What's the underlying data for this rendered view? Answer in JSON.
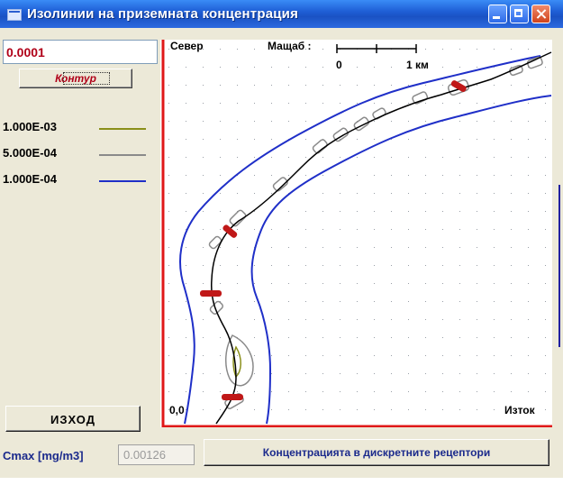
{
  "window": {
    "title": "Изолинии на приземната концентрация"
  },
  "controls": {
    "concentration_value": "0.0001",
    "contour_button": "Контур",
    "exit_button": "ИЗХОД",
    "cmax_label": "Cmax [mg/m3]",
    "cmax_value": "0.00126",
    "receptors_button": "Концентрацията в дискретните рецептори"
  },
  "legend": [
    {
      "label": "1.000E-03",
      "color": "#8a8f1a"
    },
    {
      "label": "5.000E-04",
      "color": "#8a8a8a"
    },
    {
      "label": "1.000E-04",
      "color": "#1f2fc8"
    }
  ],
  "map": {
    "north_label": "Север",
    "scale_label": "Мащаб :",
    "scale_start": "0",
    "scale_end": "1 км",
    "origin_label": "0,0",
    "east_label": "Изток",
    "axis_color": "#e01818",
    "route_color": "#000000"
  }
}
